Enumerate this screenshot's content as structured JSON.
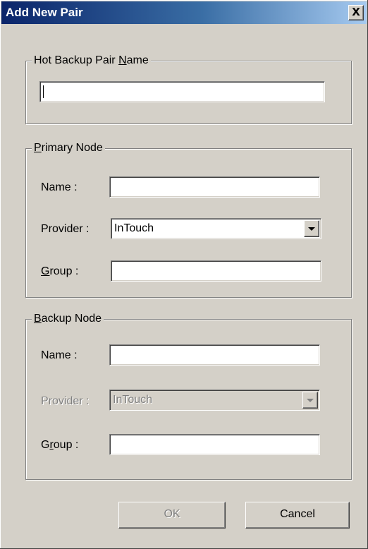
{
  "window": {
    "title": "Add New Pair",
    "close_glyph": "X"
  },
  "pair_group": {
    "legend_prefix": "Hot Backup Pair ",
    "legend_mnemonic": "N",
    "legend_suffix": "ame",
    "name_value": ""
  },
  "primary_group": {
    "legend_mnemonic": "P",
    "legend_suffix": "rimary Node",
    "name_label": "Name :",
    "name_value": "",
    "provider_label": "Provider :",
    "provider_value": "InTouch",
    "group_label_mnemonic": "G",
    "group_label_suffix": "roup :",
    "group_value": ""
  },
  "backup_group": {
    "legend_mnemonic": "B",
    "legend_suffix": "ackup Node",
    "name_label": "Name :",
    "name_value": "",
    "provider_label": "Provider :",
    "provider_value": "InTouch",
    "group_label_prefix": "G",
    "group_label_mnemonic": "r",
    "group_label_suffix": "oup :",
    "group_value": ""
  },
  "buttons": {
    "ok_label": "OK",
    "cancel_label": "Cancel"
  },
  "colors": {
    "face": "#d4d0c8",
    "title_start": "#0a246a",
    "title_end": "#a6caf0",
    "disabled_text": "#808080"
  },
  "icons": {
    "close": "close-icon",
    "dropdown": "chevron-down-icon"
  }
}
